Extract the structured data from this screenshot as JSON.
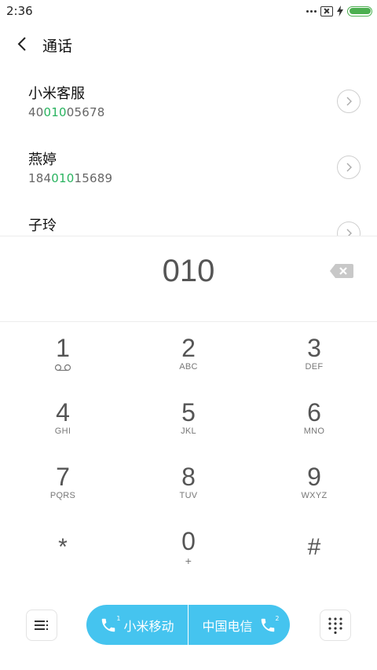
{
  "status_bar": {
    "time": "2:36",
    "icons": [
      "more-dots-icon",
      "sim-off-icon",
      "charging-icon",
      "battery-icon"
    ],
    "battery_color": "#4caf50"
  },
  "header": {
    "title": "通话",
    "back_icon": "back-arrow-icon"
  },
  "contacts": [
    {
      "name": "小米客服",
      "number_prefix": "40",
      "number_match": "010",
      "number_suffix": "05678"
    },
    {
      "name": "燕婷",
      "number_prefix": "184",
      "number_match": "010",
      "number_suffix": "15689"
    },
    {
      "name": "子玲",
      "number_prefix": "",
      "number_match": "",
      "number_suffix": ""
    }
  ],
  "highlight_color": "#29b35f",
  "dial": {
    "number": "010",
    "delete_icon": "backspace-icon"
  },
  "keypad": [
    {
      "digit": "1",
      "letters": "",
      "sub_icon": "voicemail-icon"
    },
    {
      "digit": "2",
      "letters": "ABC"
    },
    {
      "digit": "3",
      "letters": "DEF"
    },
    {
      "digit": "4",
      "letters": "GHI"
    },
    {
      "digit": "5",
      "letters": "JKL"
    },
    {
      "digit": "6",
      "letters": "MNO"
    },
    {
      "digit": "7",
      "letters": "PQRS"
    },
    {
      "digit": "8",
      "letters": "TUV"
    },
    {
      "digit": "9",
      "letters": "WXYZ"
    },
    {
      "digit": "*",
      "letters": ""
    },
    {
      "digit": "0",
      "letters": "+"
    },
    {
      "digit": "#",
      "letters": ""
    }
  ],
  "bottom_bar": {
    "menu_icon": "menu-icon",
    "grid_icon": "dialpad-grid-icon",
    "sim1": {
      "label": "小米移动",
      "slot": "1"
    },
    "sim2": {
      "label": "中国电信",
      "slot": "2"
    },
    "call_color": "#45c4ef"
  }
}
